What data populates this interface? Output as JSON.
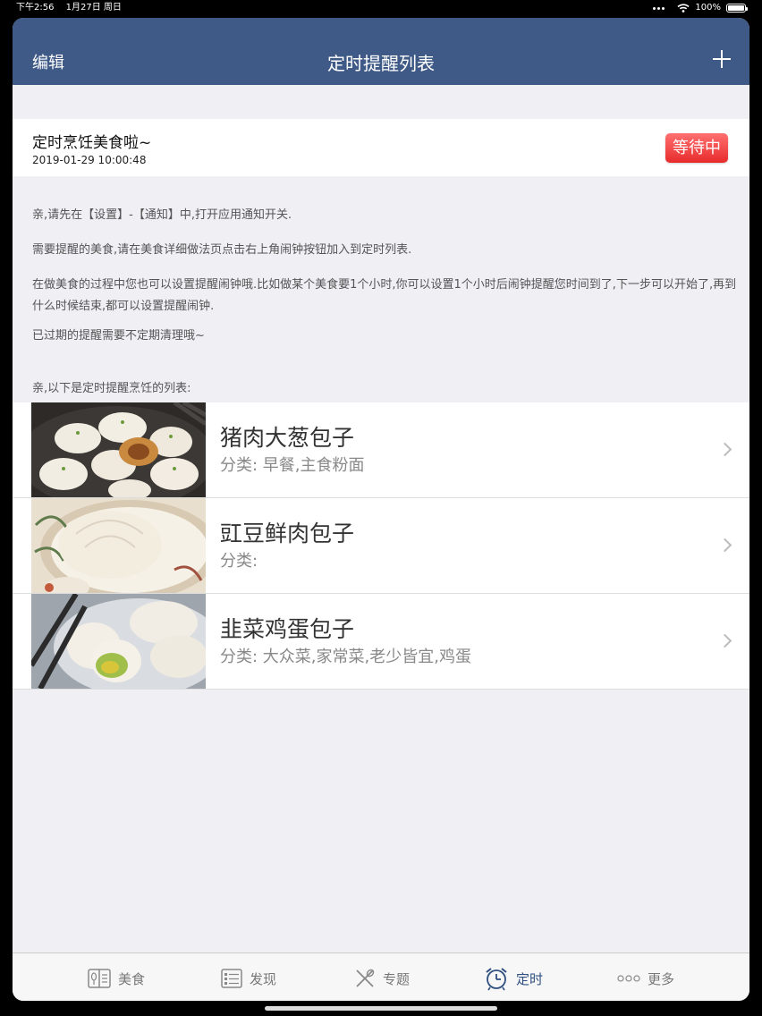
{
  "status_bar": {
    "time": "下午2:56",
    "date": "1月27日 周日",
    "battery": "100%"
  },
  "nav": {
    "left_label": "编辑",
    "title": "定时提醒列表",
    "add_icon": "plus-icon"
  },
  "reminder": {
    "title": "定时烹饪美食啦~",
    "time": "2019-01-29 10:00:48",
    "status": "等待中",
    "status_color": "#ef3a3a"
  },
  "info": {
    "line1": "亲,请先在【设置】-【通知】中,打开应用通知开关.",
    "line2": "需要提醒的美食,请在美食详细做法页点击右上角闹钟按钮加入到定时列表.",
    "line3": "在做美食的过程中您也可以设置提醒闹钟哦.比如做某个美食要1个小时,你可以设置1个小时后闹钟提醒您时间到了,下一步可以开始了,再到什么时候结束,都可以设置提醒闹钟.",
    "line4": "已过期的提醒需要不定期清理哦~",
    "list_header": "亲,以下是定时提醒烹饪的列表:"
  },
  "recipes": [
    {
      "name": "猪肉大葱包子",
      "category": "分类: 早餐,主食粉面"
    },
    {
      "name": "豇豆鲜肉包子",
      "category": "分类:"
    },
    {
      "name": "韭菜鸡蛋包子",
      "category": "分类: 大众菜,家常菜,老少皆宜,鸡蛋"
    }
  ],
  "tabs": [
    {
      "label": "美食",
      "icon": "book-icon"
    },
    {
      "label": "发现",
      "icon": "list-icon"
    },
    {
      "label": "专题",
      "icon": "utensils-icon"
    },
    {
      "label": "定时",
      "icon": "alarm-clock-icon"
    },
    {
      "label": "更多",
      "icon": "more-dots-icon"
    }
  ],
  "colors": {
    "navbar": "#3f5a86",
    "active_tab": "#2f4f80",
    "background": "#efeff4"
  }
}
